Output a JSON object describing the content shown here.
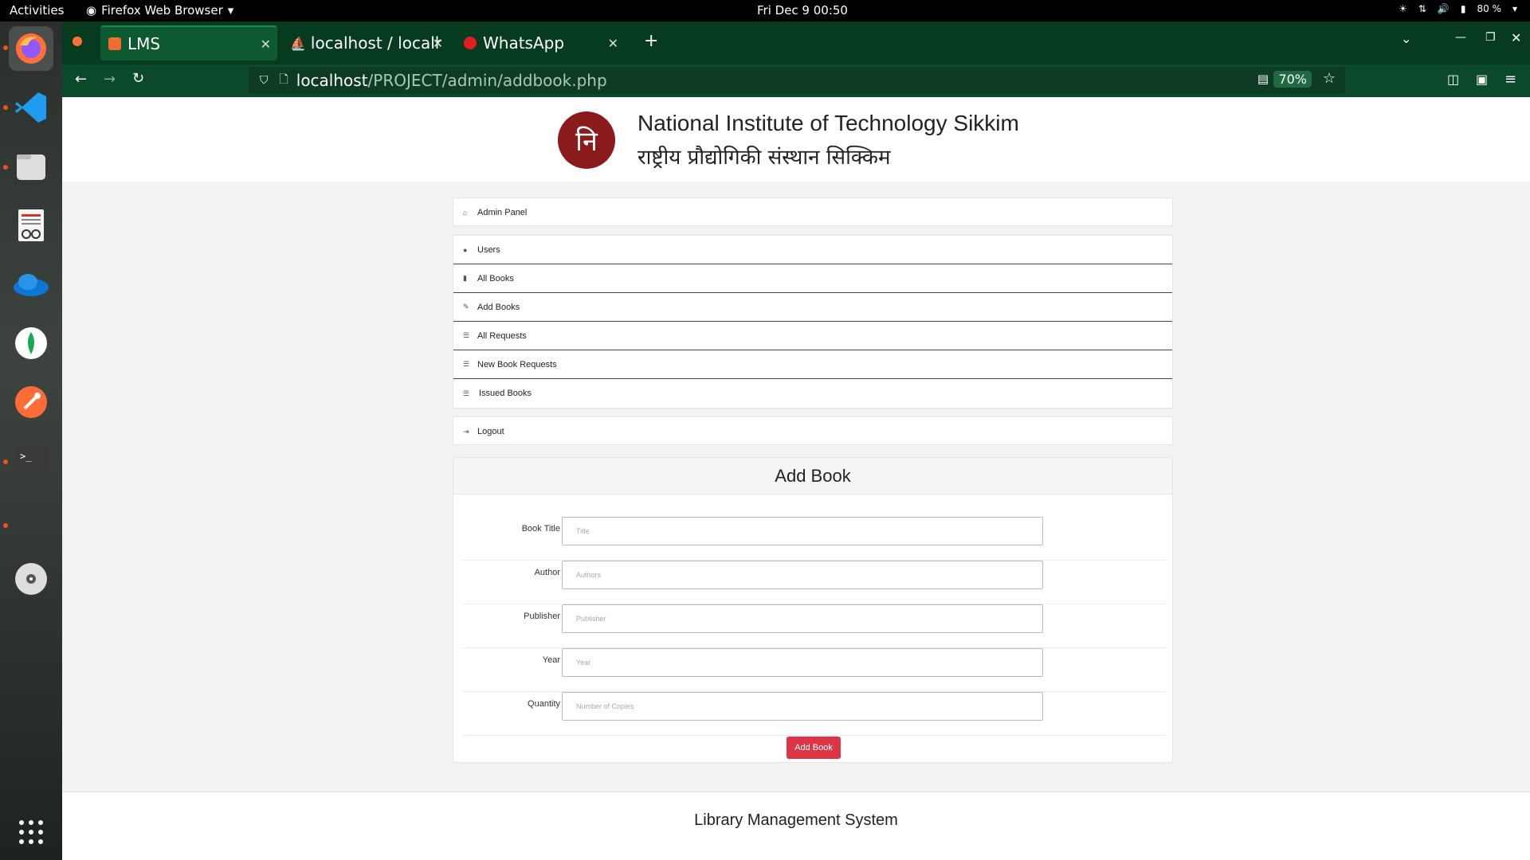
{
  "system": {
    "activities": "Activities",
    "app_menu": "Firefox Web Browser",
    "clock": "Fri Dec 9  00:50",
    "battery": "80 %"
  },
  "browser": {
    "tabs": [
      {
        "label": "LMS"
      },
      {
        "label": "localhost / localho"
      },
      {
        "label": "WhatsApp"
      }
    ],
    "url_host": "localhost",
    "url_path": "/PROJECT/admin/addbook.php",
    "zoom": "70%"
  },
  "header": {
    "logo_glyph": "नि",
    "institute_en": "National Institute of Technology Sikkim",
    "institute_hi": "राष्ट्रीय प्रौद्योगिकी संस्थान सिक्किम"
  },
  "menu": {
    "admin_panel": "Admin Panel",
    "items": [
      {
        "label": "Users",
        "icon": "user-icon"
      },
      {
        "label": "All Books",
        "icon": "book-icon"
      },
      {
        "label": "Add Books",
        "icon": "edit-icon"
      },
      {
        "label": "All Requests",
        "icon": "list-icon"
      },
      {
        "label": "New Book Requests",
        "icon": "list-icon"
      },
      {
        "label": "Issued Books",
        "icon": "list-icon"
      }
    ],
    "logout": "Logout"
  },
  "form": {
    "title": "Add Book",
    "fields": [
      {
        "label": "Book Title",
        "placeholder": "Title"
      },
      {
        "label": "Author",
        "placeholder": "Authors"
      },
      {
        "label": "Publisher",
        "placeholder": "Publisher"
      },
      {
        "label": "Year",
        "placeholder": "Year"
      },
      {
        "label": "Quantity",
        "placeholder": "Number of Copies"
      }
    ],
    "submit": "Add Book"
  },
  "footer": {
    "text": "Library Management System"
  },
  "colors": {
    "accent": "#dc3545",
    "browser_green": "#0a4a2a",
    "logo_red": "#8b1a1a"
  }
}
